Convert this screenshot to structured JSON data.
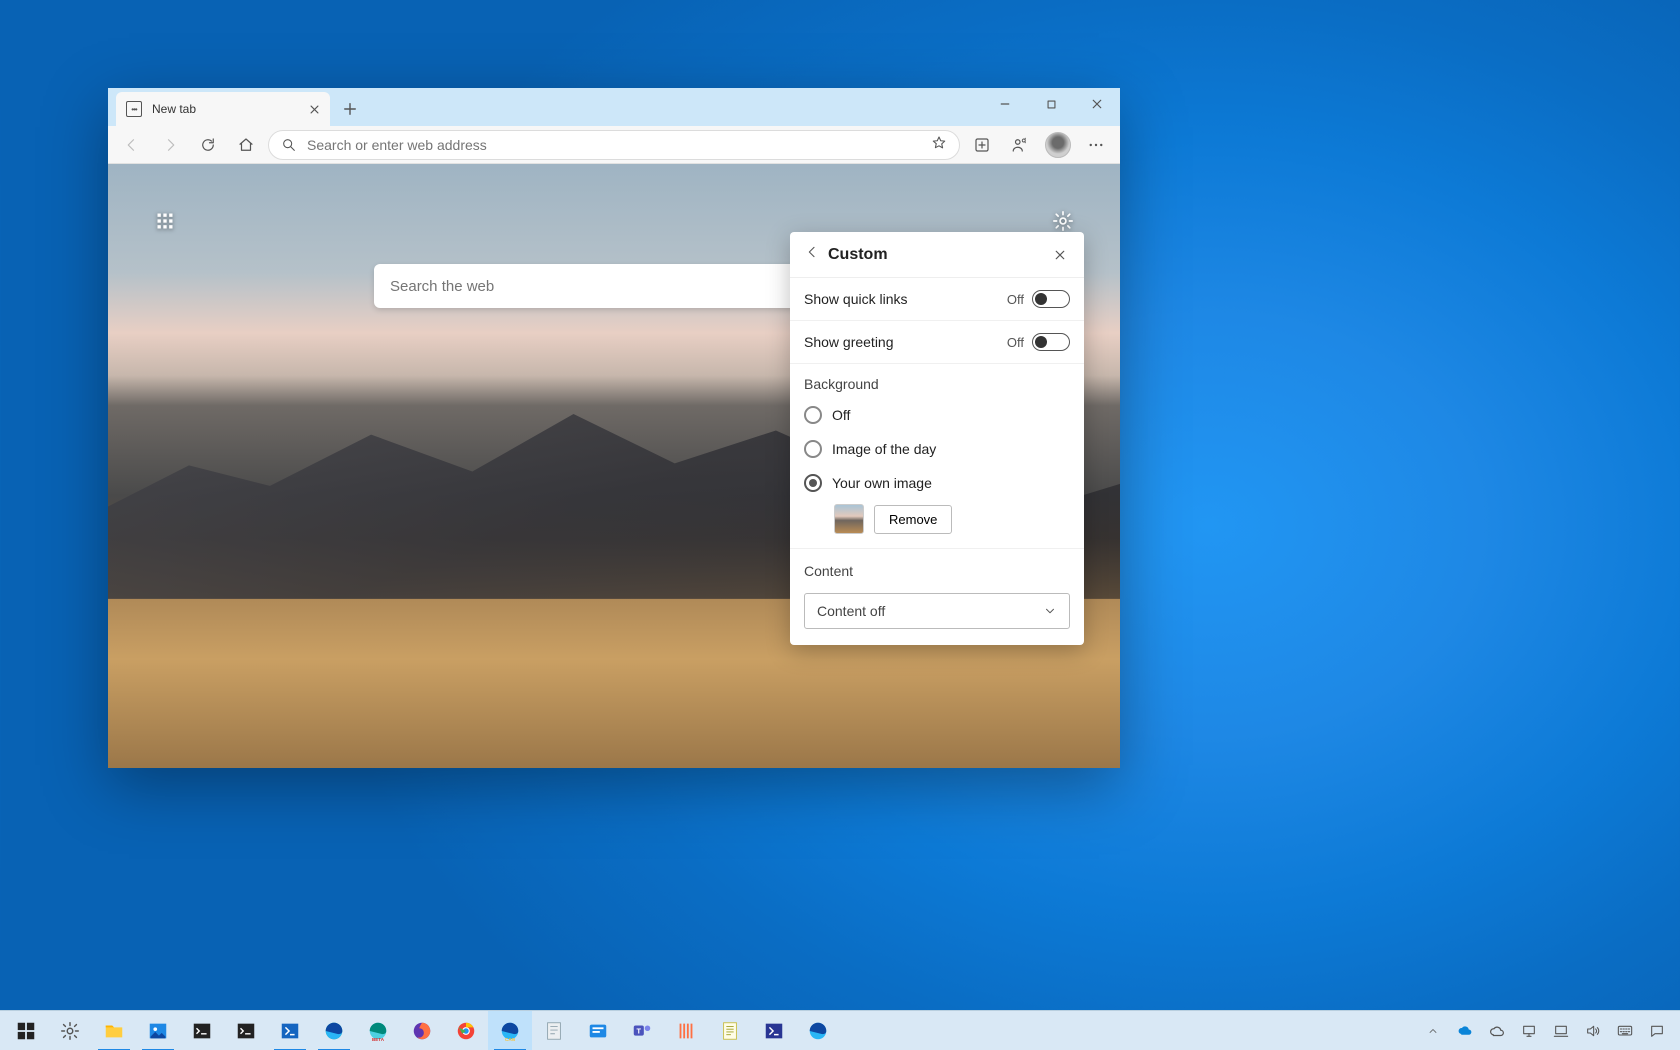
{
  "browser": {
    "tab_title": "New tab",
    "omnibox_placeholder": "Search or enter web address"
  },
  "ntp": {
    "search_placeholder": "Search the web"
  },
  "custom_panel": {
    "title": "Custom",
    "quick_links_label": "Show quick links",
    "quick_links_status": "Off",
    "greeting_label": "Show greeting",
    "greeting_status": "Off",
    "background_section": "Background",
    "radio_off": "Off",
    "radio_image_day": "Image of the day",
    "radio_own_image": "Your own image",
    "remove_btn": "Remove",
    "content_section": "Content",
    "content_select_value": "Content off"
  }
}
